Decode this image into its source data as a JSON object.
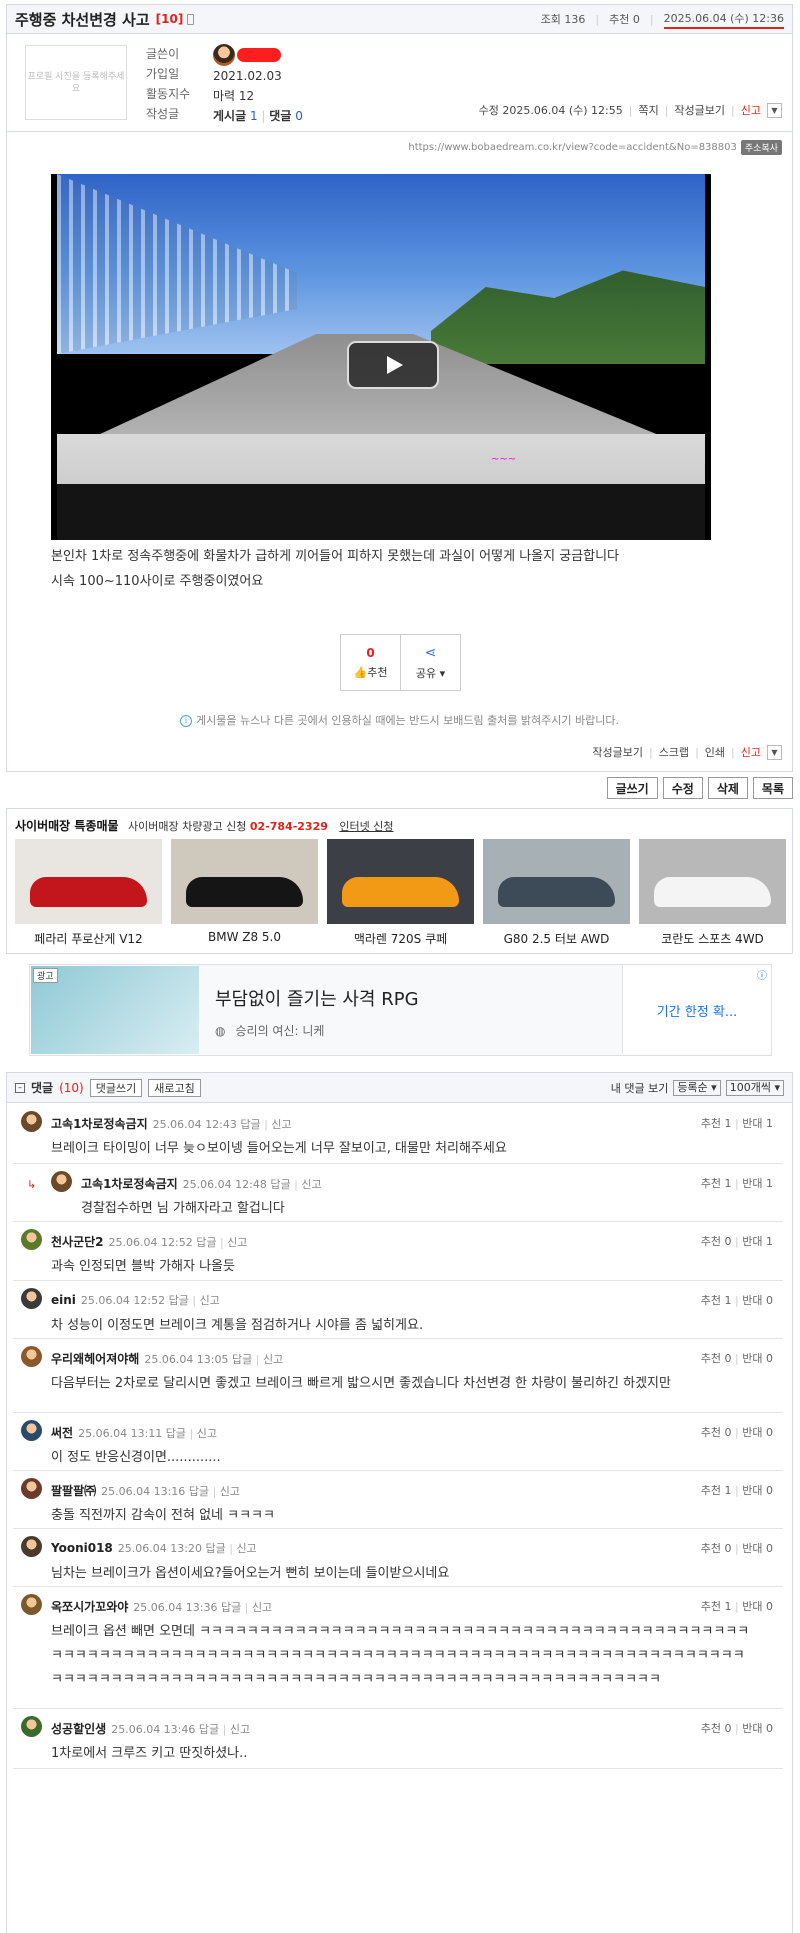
{
  "post": {
    "title": "주행중 차선변경 사고",
    "comment_count": "[10]",
    "views": "조회 136",
    "recommend": "추천 0",
    "date": "2025.06.04 (수) 12:36"
  },
  "author": {
    "photo_placeholder": "프로필 사진을 등록해주세요",
    "labels": [
      "글쓴이",
      "가입일",
      "활동지수",
      "작성글"
    ],
    "joined": "2021.02.03",
    "activity": "마력 12",
    "posts_label": "게시글",
    "posts_count": "1",
    "replies_label": "댓글",
    "replies_count": "0",
    "modified": "수정 2025.06.04 (수) 12:55",
    "memo": "쪽지",
    "view_posts": "작성글보기",
    "report": "신고"
  },
  "content": {
    "url": "https://www.bobaedream.co.kr/view?code=accident&No=838803",
    "copy_label": "주소복사",
    "lines": [
      "본인차 1차로 정속주행중에 화물차가 급하게 끼어들어 피하지 못했는데 과실이 어떻게 나올지 궁금합니다",
      "시속 100~110사이로 주행중이였어요"
    ],
    "recommend_count": "0",
    "recommend_label": "추천",
    "share_label": "공유",
    "notice": "게시물을 뉴스나 다른 곳에서 인용하실 때에는 반드시 보배드림 출처를 밝혀주시기 바랍니다.",
    "bottom_links": [
      "작성글보기",
      "스크랩",
      "인쇄",
      "신고"
    ]
  },
  "actions": [
    "글쓰기",
    "수정",
    "삭제",
    "목록"
  ],
  "cyber": {
    "title": "사이버매장 특종매물",
    "ad_text": "사이버매장 차량광고 신청",
    "phone": "02-784-2329",
    "internet": "인터넷 신청",
    "cars": [
      {
        "name": "페라리 푸로산게 V12",
        "color": "#c3161c",
        "bg": "#e9e6e2"
      },
      {
        "name": "BMW Z8 5.0",
        "color": "#151515",
        "bg": "#cfc8bd"
      },
      {
        "name": "맥라렌 720S 쿠페",
        "color": "#f29a16",
        "bg": "#3c3f45"
      },
      {
        "name": "G80 2.5 터보 AWD",
        "color": "#3d4a57",
        "bg": "#a7b0b5"
      },
      {
        "name": "코란도 스포츠 4WD",
        "color": "#f4f4f4",
        "bg": "#b8b8b8"
      }
    ]
  },
  "ad": {
    "tag": "광고",
    "title": "부담없이 즐기는 사격 RPG",
    "sub": "승리의 여신: 니케",
    "cta": "기간 한정 확...",
    "info": "ⓘ"
  },
  "comments_header": {
    "title": "댓글",
    "count": "(10)",
    "write": "댓글쓰기",
    "refresh": "새로고침",
    "mine": "내 댓글 보기",
    "sort": "등록순",
    "per_page": "100개씩"
  },
  "comments": [
    {
      "nick": "고속1차로정속금지",
      "time": "25.06.04 12:43",
      "reply": "답글",
      "report": "신고",
      "text": "브레이크 타이밍이 너무 늦ㅇ보이넹 들어오는게 너무 잘보이고, 대물만 처리해주세요",
      "rec": "추천 1",
      "opp": "반대 1",
      "avatar": "#6b4a2b"
    },
    {
      "nick": "고속1차로정속금지",
      "time": "25.06.04 12:48",
      "reply": "답글",
      "report": "신고",
      "text": "경찰접수하면 님 가해자라고 할겁니다",
      "rec": "추천 1",
      "opp": "반대 1",
      "avatar": "#6b4a2b"
    },
    {
      "nick": "천사군단2",
      "time": "25.06.04 12:52",
      "reply": "답글",
      "report": "신고",
      "text": "과속 인정되면 블박 가해자 나올듯",
      "rec": "추천 0",
      "opp": "반대 1",
      "avatar": "#5a7a2b"
    },
    {
      "nick": "eini",
      "time": "25.06.04 12:52",
      "reply": "답글",
      "report": "신고",
      "text": "차 성능이 이정도면 브레이크 계통을 점검하거나 시야를 좀 넓히게요.",
      "rec": "추천 1",
      "opp": "반대 0",
      "avatar": "#3a3a3a"
    },
    {
      "nick": "우리왜헤어져야해",
      "time": "25.06.04 13:05",
      "reply": "답글",
      "report": "신고",
      "text": "다음부터는 2차로로 달리시면 좋겠고 브레이크 빠르게 밟으시면 좋겠습니다 차선변경 한 차량이 불리하긴 하겠지만",
      "rec": "추천 0",
      "opp": "반대 0",
      "avatar": "#8a5a2b"
    },
    {
      "nick": "써전",
      "time": "25.06.04 13:11",
      "reply": "답글",
      "report": "신고",
      "text": "이 정도 반응신경이면.............",
      "rec": "추천 0",
      "opp": "반대 0",
      "avatar": "#2b4a6b"
    },
    {
      "nick": "팔팔팔㈜",
      "time": "25.06.04 13:16",
      "reply": "답글",
      "report": "신고",
      "text": "충돌 직전까지 감속이 전혀 없네 ㅋㅋㅋㅋ",
      "rec": "추천 1",
      "opp": "반대 0",
      "avatar": "#6b3a2b"
    },
    {
      "nick": "Yooni018",
      "time": "25.06.04 13:20",
      "reply": "답글",
      "report": "신고",
      "text": "님차는 브레이크가 옵션이세요?들어오는거 뻔히 보이는데 들이받으시네요",
      "rec": "추천 0",
      "opp": "반대 0",
      "avatar": "#4a3a2b"
    },
    {
      "nick": "옥쪼시가꼬와야",
      "time": "25.06.04 13:36",
      "reply": "답글",
      "report": "신고",
      "text": "브레이크 옵션 빼면 오면데 ㅋㅋㅋㅋㅋㅋㅋㅋㅋㅋㅋㅋㅋㅋㅋㅋㅋㅋㅋㅋㅋㅋㅋㅋㅋㅋㅋㅋㅋㅋㅋㅋㅋㅋㅋㅋㅋㅋㅋㅋㅋㅋㅋㅋㅋㅋㅋㅋㅋㅋㅋㅋㅋㅋㅋㅋㅋㅋㅋㅋㅋㅋㅋㅋㅋㅋㅋㅋㅋㅋㅋㅋㅋㅋㅋㅋㅋㅋㅋㅋㅋㅋㅋㅋㅋㅋㅋㅋㅋㅋㅋㅋㅋㅋㅋㅋㅋㅋㅋㅋㅋㅋㅋㅋㅋㅋㅋㅋㅋㅋㅋㅋㅋㅋㅋㅋㅋㅋㅋㅋㅋㅋㅋㅋㅋㅋㅋㅋㅋㅋㅋㅋㅋㅋㅋㅋㅋㅋㅋㅋㅋㅋㅋㅋㅋㅋㅋㅋㅋㅋㅋㅋㅋㅋㅋ",
      "rec": "추천 1",
      "opp": "반대 0",
      "avatar": "#7a5a2b"
    },
    {
      "nick": "성공할인생",
      "time": "25.06.04 13:46",
      "reply": "답글",
      "report": "신고",
      "text": "1차로에서 크루즈 키고 딴짓하셨나..",
      "rec": "추천 0",
      "opp": "반대 0",
      "avatar": "#3a6b2b"
    }
  ]
}
